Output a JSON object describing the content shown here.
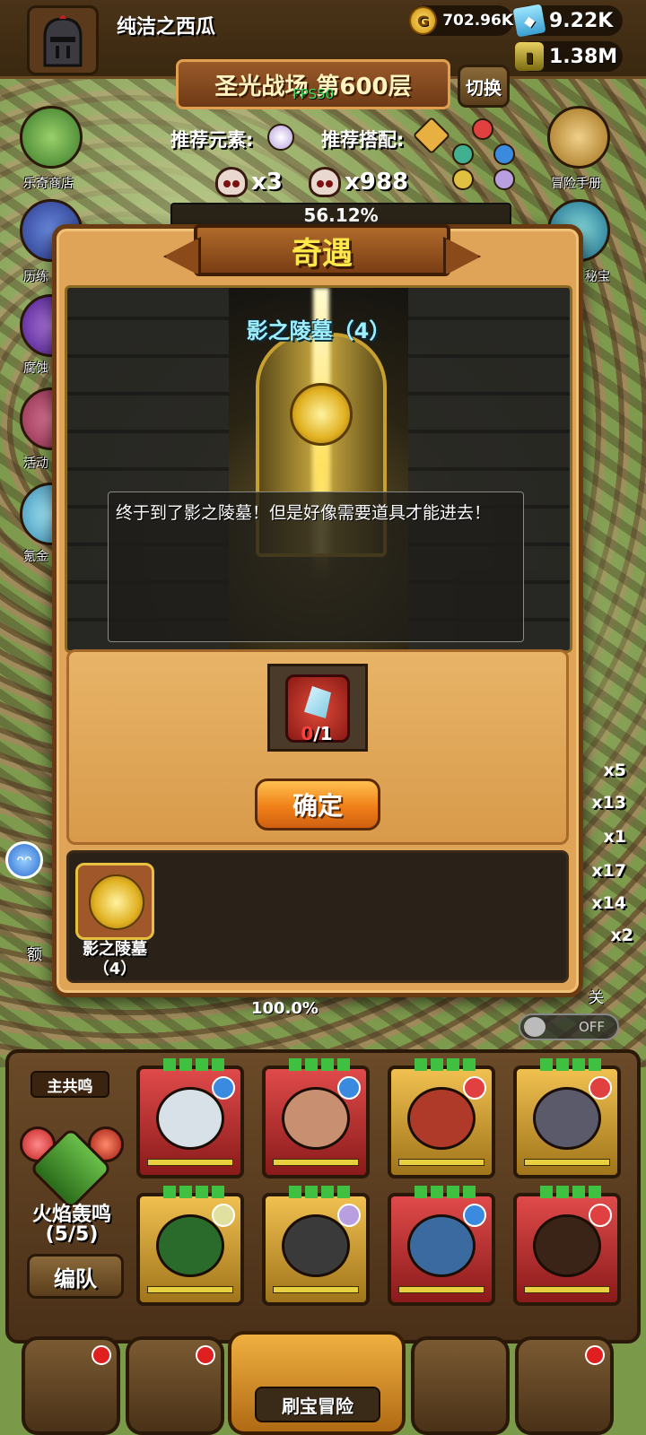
{
  "player": {
    "name": "纯洁之西瓜"
  },
  "resources": {
    "gold": "702.96K",
    "gems": "9.22K",
    "potion": "1.38M"
  },
  "stage": {
    "title": "圣光战场 第600层",
    "fps": "FPS50",
    "switch_label": "切换"
  },
  "recommend": {
    "element_label": "推荐元素:",
    "combo_label": "推荐搭配:"
  },
  "enemies": {
    "boss_count": "x3",
    "minion_count": "x988",
    "progress": "56.12%"
  },
  "side_menu_left": [
    {
      "label": "乐奇商店",
      "icon": "clover-icon"
    },
    {
      "label": "历练",
      "icon": "cup-icon"
    },
    {
      "label": "腐蚀",
      "icon": "orb-icon"
    },
    {
      "label": "活动",
      "icon": "gift-icon"
    },
    {
      "label": "氪金",
      "icon": "diamond-icon"
    }
  ],
  "side_menu_right": [
    {
      "label": "冒险手册",
      "icon": "scroll-icon"
    },
    {
      "label": "秘宝",
      "icon": "chest-icon"
    }
  ],
  "multipliers": [
    "x5",
    "x13",
    "x1",
    "x17",
    "x14",
    "x2"
  ],
  "modal": {
    "title": "奇遇",
    "dungeon_name": "影之陵墓（4）",
    "story": "终于到了影之陵墓！但是好像需要道具才能进去！",
    "required_item": {
      "current": "0",
      "total": "/1",
      "icon": "crystal-stone-icon"
    },
    "confirm_label": "确定",
    "list": [
      {
        "label_line1": "影之陵墓",
        "label_line2": "（4）"
      }
    ]
  },
  "bottom": {
    "progress_text": "100.0%",
    "toggle_label": "OFF",
    "side_text_left": "额",
    "side_text_right": "关"
  },
  "team": {
    "main_resonance_label": "主共鸣",
    "resonance_name": "火焰轰鸣",
    "resonance_count": "(5/5)",
    "formation_label": "编队"
  },
  "nav": {
    "center_label": "刷宝冒险"
  },
  "colors": {
    "accent_orange": "#f08018",
    "title_yellow": "#ffe94a",
    "dungeon_cyan": "#9ef0ff",
    "count_red": "#ff4040",
    "fps_green": "#3ee060"
  }
}
